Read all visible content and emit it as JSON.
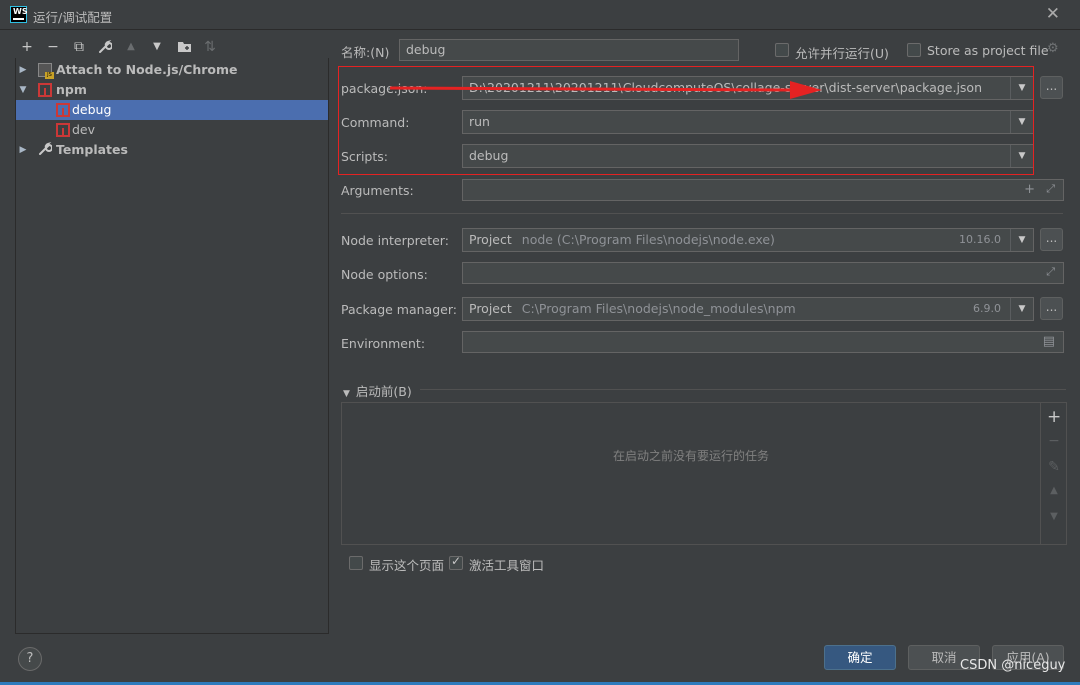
{
  "window": {
    "title": "运行/调试配置",
    "logo": "WS"
  },
  "toolbar": [
    {
      "name": "add-config-icon",
      "glyph": "+",
      "enabled": true
    },
    {
      "name": "remove-config-icon",
      "glyph": "−",
      "enabled": true
    },
    {
      "name": "copy-config-icon",
      "glyph": "⧉",
      "enabled": true
    },
    {
      "name": "wrench-icon",
      "glyph": "🔧",
      "enabled": true
    },
    {
      "name": "move-up-icon",
      "glyph": "▲",
      "enabled": false
    },
    {
      "name": "move-down-icon",
      "glyph": "▼",
      "enabled": true
    },
    {
      "name": "new-folder-icon",
      "glyph": "📁",
      "enabled": true
    },
    {
      "name": "sort-icon",
      "glyph": "⇅",
      "enabled": false
    }
  ],
  "tree": {
    "attach": "Attach to Node.js/Chrome",
    "npm": "npm",
    "debug": "debug",
    "dev": "dev",
    "templates": "Templates"
  },
  "form": {
    "name_label": "名称:(N)",
    "name_value": "debug",
    "allow_parallel": "允许并行运行(U)",
    "store_as_project": "Store as project file",
    "package_json_label": "package.json:",
    "package_json_value": "D:\\20201211\\20201211\\CloudcomputeOS\\collage-server\\dist-server\\package.json",
    "command_label": "Command:",
    "command_value": "run",
    "scripts_label": "Scripts:",
    "scripts_value": "debug",
    "arguments_label": "Arguments:",
    "node_interpreter_label": "Node interpreter:",
    "node_interpreter_scope": "Project",
    "node_interpreter_path": "node (C:\\Program Files\\nodejs\\node.exe)",
    "node_version": "10.16.0",
    "node_options_label": "Node options:",
    "package_manager_label": "Package manager:",
    "package_manager_scope": "Project",
    "package_manager_path": "C:\\Program Files\\nodejs\\node_modules\\npm",
    "package_manager_version": "6.9.0",
    "environment_label": "Environment:",
    "browse": "..."
  },
  "before_launch": {
    "header": "启动前(B)",
    "empty_text": "在启动之前没有要运行的任务"
  },
  "options": {
    "show_page": "显示这个页面",
    "activate_tool": "激活工具窗口"
  },
  "buttons": {
    "ok": "确定",
    "cancel": "取消",
    "apply": "应用(A)",
    "help": "?"
  },
  "watermark": "CSDN @niceguy",
  "colors": {
    "background": "#3c3f41",
    "selection": "#4b6eaf",
    "primary_button": "#365880",
    "annotation_red": "#e52222"
  }
}
